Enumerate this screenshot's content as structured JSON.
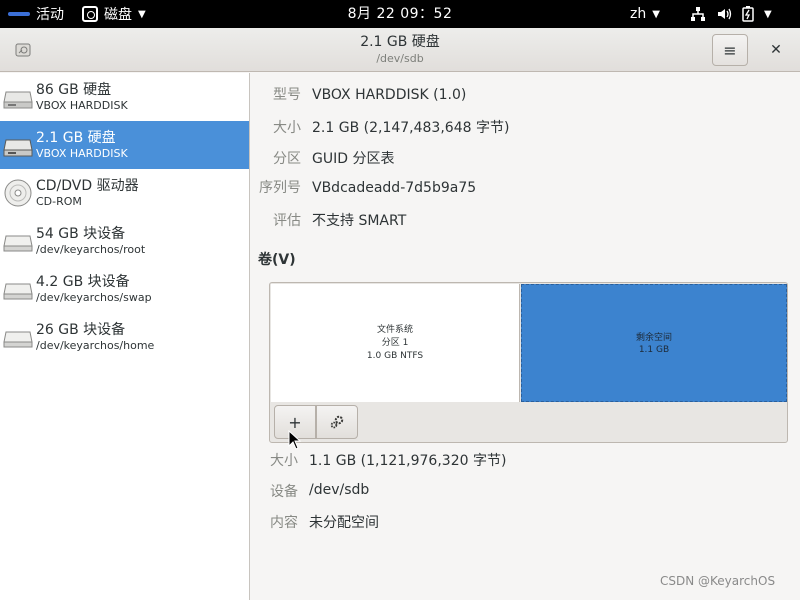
{
  "topbar": {
    "activities": "活动",
    "app_name": "磁盘",
    "clock": "8月 22  09：52",
    "lang": "zh"
  },
  "header": {
    "title": "2.1 GB 硬盘",
    "subtitle": "/dev/sdb",
    "menu_glyph": "≡",
    "close_glyph": "✕"
  },
  "sidebar": {
    "items": [
      {
        "name": "86 GB 硬盘",
        "sub": "VBOX HARDDISK",
        "icon": "harddisk-icon"
      },
      {
        "name": "2.1 GB 硬盘",
        "sub": "VBOX HARDDISK",
        "icon": "harddisk-icon",
        "selected": true
      },
      {
        "name": "CD/DVD 驱动器",
        "sub": "CD-ROM",
        "icon": "optical-disc-icon"
      },
      {
        "name": "54 GB 块设备",
        "sub": "/dev/keyarchos/root",
        "icon": "block-device-icon"
      },
      {
        "name": "4.2 GB 块设备",
        "sub": "/dev/keyarchos/swap",
        "icon": "block-device-icon"
      },
      {
        "name": "26 GB 块设备",
        "sub": "/dev/keyarchos/home",
        "icon": "block-device-icon"
      }
    ]
  },
  "drive": {
    "model_label": "型号",
    "model": "VBOX HARDDISK (1.0)",
    "size_label": "大小",
    "size": "2.1 GB (2,147,483,648 字节)",
    "partitioning_label": "分区",
    "partitioning": "GUID 分区表",
    "serial_label": "序列号",
    "serial": "VBdcadeadd-7d5b9a75",
    "assessment_label": "评估",
    "assessment": "不支持 SMART"
  },
  "volumes": {
    "title": "卷(V)",
    "fs": {
      "line1": "文件系统",
      "line2": "分区 1",
      "line3": "1.0 GB NTFS"
    },
    "free": {
      "line1": "剩余空间",
      "line2": "1.1 GB"
    },
    "add_glyph": "+"
  },
  "selection": {
    "size_label": "大小",
    "size": "1.1 GB (1,121,976,320 字节)",
    "device_label": "设备",
    "device": "/dev/sdb",
    "contents_label": "内容",
    "contents": "未分配空间"
  },
  "watermark": "CSDN @KeyarchOS",
  "colors": {
    "selection": "#4a90d9",
    "free_space": "#3c83cf",
    "topbar": "#000000"
  }
}
